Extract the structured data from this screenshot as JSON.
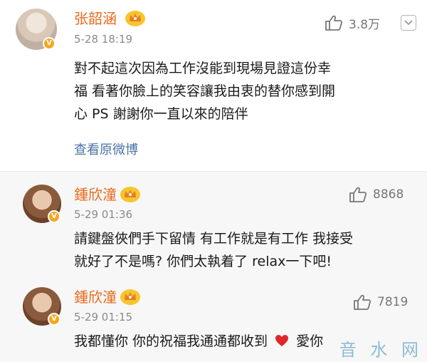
{
  "post": {
    "author": "张韶涵",
    "time": "5-28 18:19",
    "likes": "3.8万",
    "text_lines": [
      "對不起這次因為工作沒能到現場見證這份幸",
      "福 看著你臉上的笑容讓我由衷的替你感到開",
      "心 PS 謝謝你一直以來的陪伴"
    ],
    "view_original": "查看原微博"
  },
  "comments": [
    {
      "author": "鍾欣潼",
      "time": "5-29 01:36",
      "likes": "8868",
      "text_lines": [
        "請鍵盤俠們手下留情 有工作就是有工作 我接受",
        "就好了不是嗎? 你們太執着了 relax一下吧!"
      ]
    },
    {
      "author": "鍾欣潼",
      "time": "5-29 01:15",
      "likes": "7819",
      "text_before": "我都懂你 你的祝福我通通都收到",
      "text_after": "愛你"
    }
  ],
  "watermark": "音 水 网",
  "icons": {
    "like": "thumbs-up-icon",
    "verified": "verified-v-icon",
    "vip": "crown-icon",
    "heart": "heart-emoji-icon",
    "more": "chevron-down-icon"
  },
  "colors": {
    "name": "#e86a1c",
    "link": "#4a74a6",
    "comment_bg": "#f7f7f7",
    "heart": "#e0262b"
  }
}
